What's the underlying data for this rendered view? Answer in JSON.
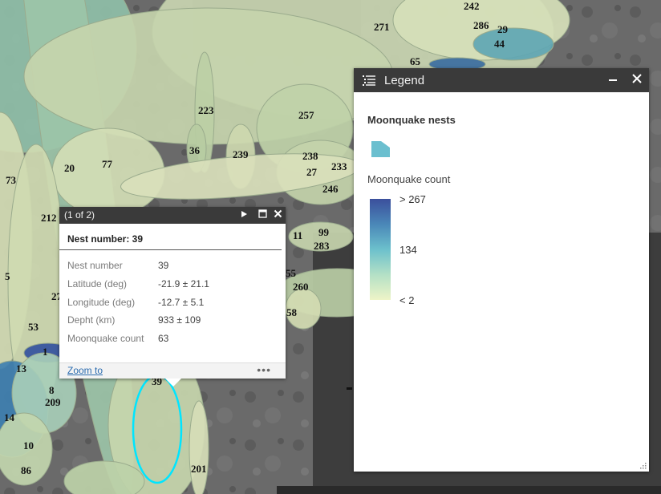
{
  "map": {
    "nest_labels": [
      {
        "text": "242"
      },
      {
        "text": "271"
      },
      {
        "text": "286"
      },
      {
        "text": "29"
      },
      {
        "text": "44"
      },
      {
        "text": "65"
      },
      {
        "text": "223"
      },
      {
        "text": "257"
      },
      {
        "text": "36"
      },
      {
        "text": "239"
      },
      {
        "text": "238"
      },
      {
        "text": "233"
      },
      {
        "text": "27"
      },
      {
        "text": "246"
      },
      {
        "text": "20"
      },
      {
        "text": "77"
      },
      {
        "text": "73"
      },
      {
        "text": "212"
      },
      {
        "text": "11"
      },
      {
        "text": "99"
      },
      {
        "text": "283"
      },
      {
        "text": "55"
      },
      {
        "text": "260"
      },
      {
        "text": "58"
      },
      {
        "text": "5"
      },
      {
        "text": "27"
      },
      {
        "text": "53"
      },
      {
        "text": "1"
      },
      {
        "text": "13"
      },
      {
        "text": "8"
      },
      {
        "text": "209"
      },
      {
        "text": "14"
      },
      {
        "text": "10"
      },
      {
        "text": "86"
      },
      {
        "text": "39"
      },
      {
        "text": "201"
      }
    ]
  },
  "popup": {
    "title": "(1 of 2)",
    "heading": "Nest number: 39",
    "fields": [
      {
        "label": "Nest number",
        "value": "39"
      },
      {
        "label": "Latitude (deg)",
        "value": "-21.9 ± 21.1"
      },
      {
        "label": "Longitude (deg)",
        "value": "-12.7 ± 5.1"
      },
      {
        "label": "Depht (km)",
        "value": "933 ± 109"
      },
      {
        "label": "Moonquake count",
        "value": "63"
      }
    ],
    "zoom_label": "Zoom to",
    "more_label": "•••",
    "next_icon": "play-icon",
    "maximize_icon": "maximize-icon",
    "close_icon": "close-icon"
  },
  "legend": {
    "title": "Legend",
    "layer_name": "Moonquake nests",
    "field_name": "Moonquake count",
    "ramp_labels": {
      "max": "> 267",
      "mid": "134",
      "min": "< 2"
    },
    "ramp_colors": [
      "#3b4f9c",
      "#4a87b8",
      "#6cc0cc",
      "#b3e0c6",
      "#eef4c7"
    ],
    "swatch_color": "#6bbfcf",
    "minimize_icon": "minimize-icon",
    "close_icon": "close-icon",
    "menu_icon": "list-icon"
  }
}
